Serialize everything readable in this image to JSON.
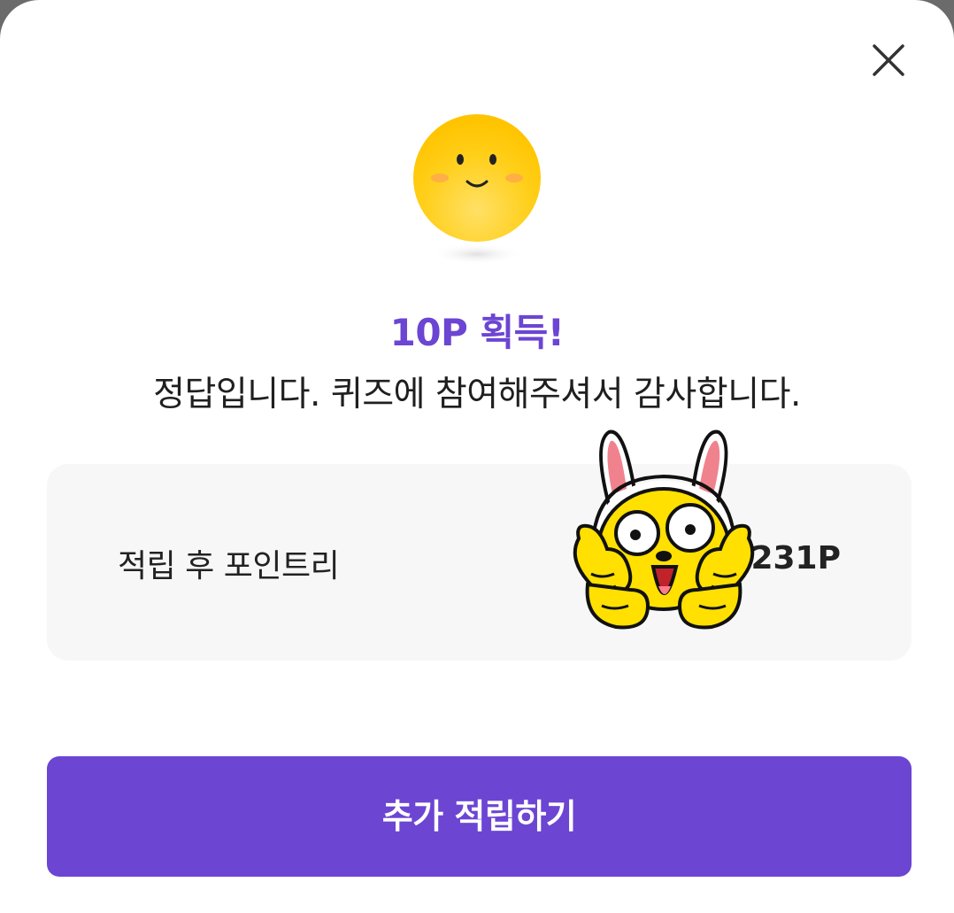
{
  "modal": {
    "headline": "10P 획득!",
    "message": "정답입니다. 퀴즈에 참여해주셔서 감사합니다."
  },
  "points": {
    "label": "적립 후 포인트리",
    "value": "1,231P"
  },
  "actions": {
    "primary_label": "추가 적립하기"
  },
  "icons": {
    "close": "close-icon",
    "emoji": "smiling-face-icon",
    "sticker": "bunny-ear-character-sticker"
  },
  "colors": {
    "accent": "#6c45d3",
    "card_background": "#f7f7f7",
    "emoji_yellow": "#ffcc00"
  }
}
